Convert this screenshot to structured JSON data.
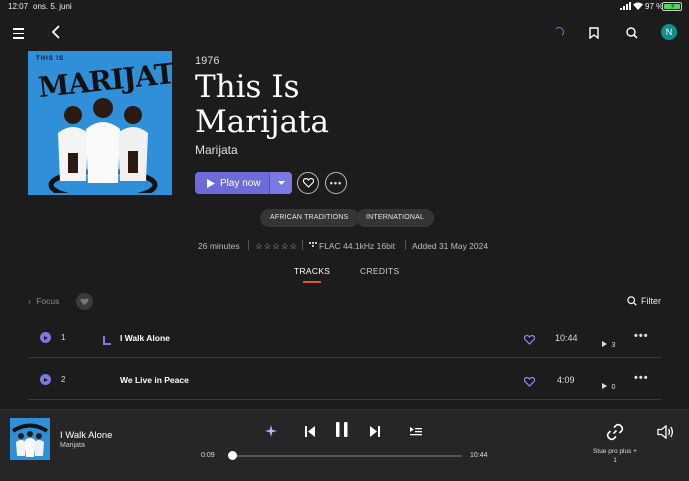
{
  "status_bar": {
    "time": "12:07",
    "date": "ons. 5. juni",
    "battery": "97 %",
    "battery_level": 0.97
  },
  "album": {
    "cover_top_text": "THIS IS",
    "cover_logo_text": "MARIJATA",
    "year": "1976",
    "title_line1": "This Is",
    "title_line2": "Marijata",
    "artist": "Marijata"
  },
  "actions": {
    "play_label": "Play now"
  },
  "tags": [
    "AFRICAN TRADITIONS",
    "INTERNATIONAL"
  ],
  "meta": {
    "duration": "26 minutes",
    "format": "FLAC 44.1kHz 16bit",
    "added": "Added 31 May 2024",
    "rating_stars": 0,
    "rating_max": 5
  },
  "tabs": {
    "tracks": "TRACKS",
    "credits": "CREDITS",
    "active": "tracks"
  },
  "list_tools": {
    "focus": "Focus",
    "filter": "Filter"
  },
  "tracks": [
    {
      "number": "1",
      "title": "I Walk Alone",
      "duration": "10:44",
      "plays": "3",
      "playing": true
    },
    {
      "number": "2",
      "title": "We Live in Peace",
      "duration": "4:09",
      "plays": "0",
      "playing": false
    }
  ],
  "player": {
    "title": "I Walk Alone",
    "artist": "Marijata",
    "elapsed": "0:09",
    "total": "10:44",
    "progress": 0.014,
    "device_line1": "Stue pro plus +",
    "device_line2": "1"
  },
  "colors": {
    "accent": "#6d6bd8",
    "tab_underline": "#e0533f",
    "avatar": "#0f8f8c"
  },
  "header": {
    "avatar_letter": "N"
  }
}
